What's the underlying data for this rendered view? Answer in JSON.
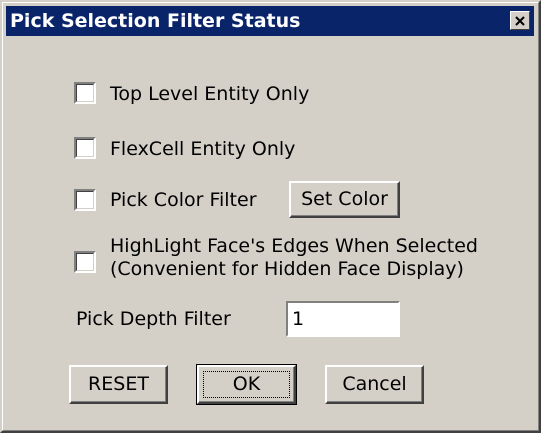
{
  "dialog": {
    "title": "Pick Selection Filter Status",
    "close_icon": "close-icon"
  },
  "options": {
    "top_level_entity_only": {
      "label": "Top Level Entity Only",
      "checked": false
    },
    "flexcell_entity_only": {
      "label": "FlexCell Entity Only",
      "checked": false
    },
    "pick_color_filter": {
      "label": "Pick Color Filter",
      "checked": false
    },
    "highlight_face_edges": {
      "label_line1": "HighLight Face's Edges When Selected",
      "label_line2": "(Convenient for Hidden Face Display)",
      "checked": false
    }
  },
  "buttons": {
    "set_color": "Set Color",
    "reset": "RESET",
    "ok": "OK",
    "cancel": "Cancel"
  },
  "pick_depth": {
    "label": "Pick Depth Filter",
    "value": "1"
  },
  "colors": {
    "face": "#d4d0c8",
    "titlebar": "#0a246a"
  }
}
